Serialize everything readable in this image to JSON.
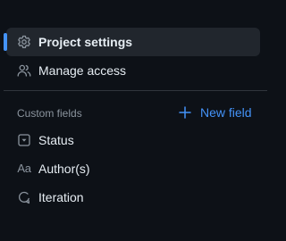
{
  "nav": {
    "items": [
      {
        "label": "Project settings",
        "icon": "gear-icon",
        "active": true
      },
      {
        "label": "Manage access",
        "icon": "people-icon",
        "active": false
      }
    ]
  },
  "custom_fields": {
    "title": "Custom fields",
    "new_field_label": "New field",
    "new_field_icon": "plus-icon",
    "items": [
      {
        "label": "Status",
        "icon": "single-select-icon"
      },
      {
        "label": "Author(s)",
        "icon": "text-field-icon",
        "glyph": "Aa"
      },
      {
        "label": "Iteration",
        "icon": "iteration-icon"
      }
    ]
  },
  "colors": {
    "background": "#0d1117",
    "accent": "#4493f8",
    "text": "#e6edf3",
    "muted": "#8b949e",
    "active_bg": "#21262d",
    "divider": "#30363d"
  }
}
